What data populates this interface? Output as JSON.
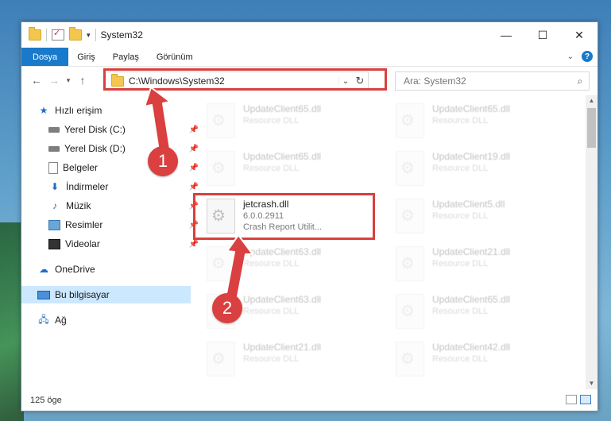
{
  "window": {
    "title": "System32"
  },
  "ribbon": {
    "tabs": [
      "Dosya",
      "Giriş",
      "Paylaş",
      "Görünüm"
    ],
    "help": "?"
  },
  "address": {
    "path": "C:\\Windows\\System32"
  },
  "search": {
    "placeholder": "Ara: System32"
  },
  "nav": {
    "items": [
      {
        "label": "Hızlı erişim",
        "icon": "star-icon"
      },
      {
        "label": "Yerel Disk (C:)",
        "icon": "disk-icon",
        "pinned": true
      },
      {
        "label": "Yerel Disk (D:)",
        "icon": "disk-icon",
        "pinned": true
      },
      {
        "label": "Belgeler",
        "icon": "document-icon",
        "pinned": true
      },
      {
        "label": "İndirmeler",
        "icon": "download-icon",
        "pinned": true
      },
      {
        "label": "Müzik",
        "icon": "music-icon",
        "pinned": true
      },
      {
        "label": "Resimler",
        "icon": "pictures-icon",
        "pinned": true
      },
      {
        "label": "Videolar",
        "icon": "video-icon",
        "pinned": true
      },
      {
        "label": "OneDrive",
        "icon": "cloud-icon"
      },
      {
        "label": "Bu bilgisayar",
        "icon": "computer-icon",
        "selected": true
      },
      {
        "label": "Ağ",
        "icon": "network-icon"
      }
    ]
  },
  "files": [
    {
      "name": "UpdateClient65.dll",
      "sub": "Resource DLL"
    },
    {
      "name": "UpdateClient65.dll",
      "sub": "Resource DLL"
    },
    {
      "name": "UpdateClient65.dll",
      "sub": "Resource DLL"
    },
    {
      "name": "UpdateClient19.dll",
      "sub": "Resource DLL"
    },
    {
      "name": "jetcrash.dll",
      "sub": "6.0.0.2911",
      "sub2": "Crash Report Utilit...",
      "highlight": true
    },
    {
      "name": "UpdateClient5.dll",
      "sub": "Resource DLL"
    },
    {
      "name": "UpdateClient63.dll",
      "sub": "Resource DLL"
    },
    {
      "name": "UpdateClient21.dll",
      "sub": "Resource DLL"
    },
    {
      "name": "UpdateClient63.dll",
      "sub": "Resource DLL"
    },
    {
      "name": "UpdateClient65.dll",
      "sub": "Resource DLL"
    },
    {
      "name": "UpdateClient21.dll",
      "sub": "Resource DLL"
    },
    {
      "name": "UpdateClient42.dll",
      "sub": "Resource DLL"
    }
  ],
  "status": {
    "count": "125 öge"
  },
  "annotations": {
    "step1": "1",
    "step2": "2"
  },
  "colors": {
    "accent": "#1979ca",
    "annotation": "#d9403f"
  }
}
